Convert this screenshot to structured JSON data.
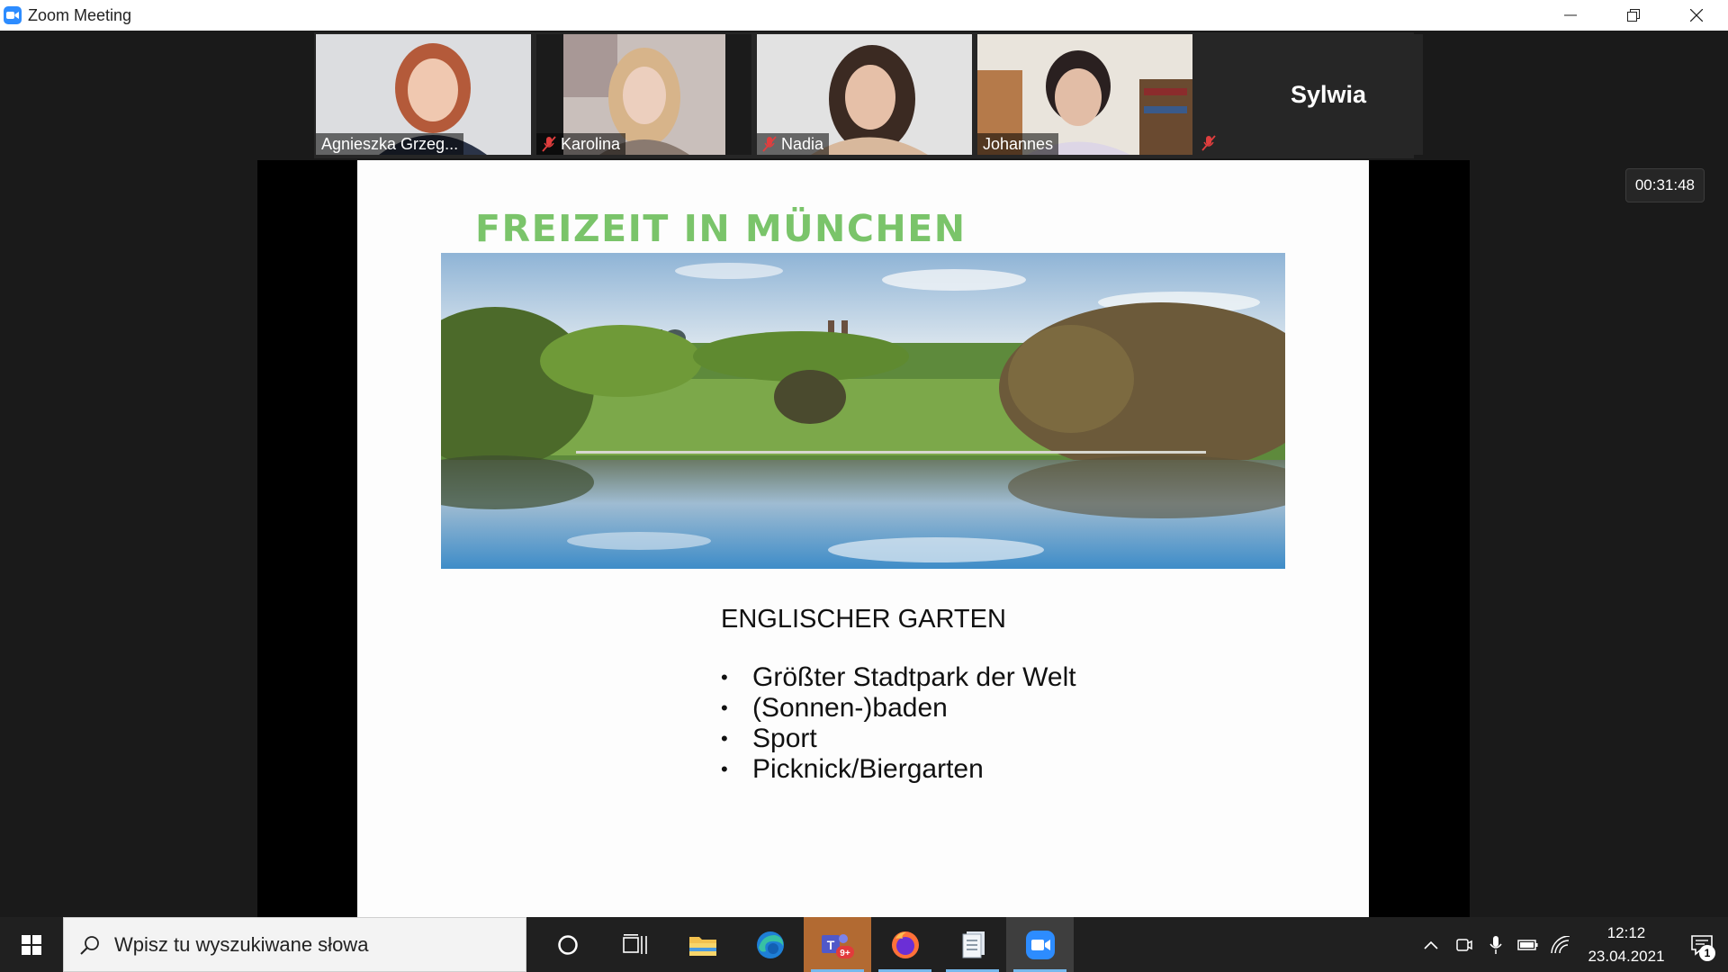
{
  "window": {
    "title": "Zoom Meeting",
    "controls": [
      "minimize",
      "restore",
      "close"
    ]
  },
  "participants": [
    {
      "name": "Agnieszka Grzeg...",
      "muted": false,
      "video": true,
      "active_speaker": false
    },
    {
      "name": "Karolina",
      "muted": true,
      "video": true,
      "active_speaker": false
    },
    {
      "name": "Nadia",
      "muted": true,
      "video": true,
      "active_speaker": false
    },
    {
      "name": "Johannes",
      "muted": false,
      "video": true,
      "active_speaker": true
    },
    {
      "name": "Sylwia",
      "muted": true,
      "video": false,
      "active_speaker": false
    }
  ],
  "meeting_timer": "00:31:48",
  "slide": {
    "title": "FREIZEIT IN MÜNCHEN",
    "subtitle": "ENGLISCHER GARTEN",
    "bullets": [
      "Größter Stadtpark der Welt",
      "(Sonnen-)baden",
      "Sport",
      "Picknick/Biergarten"
    ],
    "title_color": "#7ac46a"
  },
  "taskbar": {
    "search_placeholder": "Wpisz tu wyszukiwane słowa",
    "apps": [
      {
        "name": "cortana",
        "icon": "circle-icon"
      },
      {
        "name": "task-view",
        "icon": "task-view-icon"
      },
      {
        "name": "file-explorer",
        "icon": "folder-icon"
      },
      {
        "name": "edge",
        "icon": "edge-icon"
      },
      {
        "name": "teams",
        "icon": "teams-icon",
        "badge": "9+"
      },
      {
        "name": "firefox",
        "icon": "firefox-icon"
      },
      {
        "name": "documents",
        "icon": "documents-icon"
      },
      {
        "name": "zoom",
        "icon": "zoom-icon"
      }
    ],
    "time": "12:12",
    "date": "23.04.2021",
    "notification_count": "1"
  }
}
